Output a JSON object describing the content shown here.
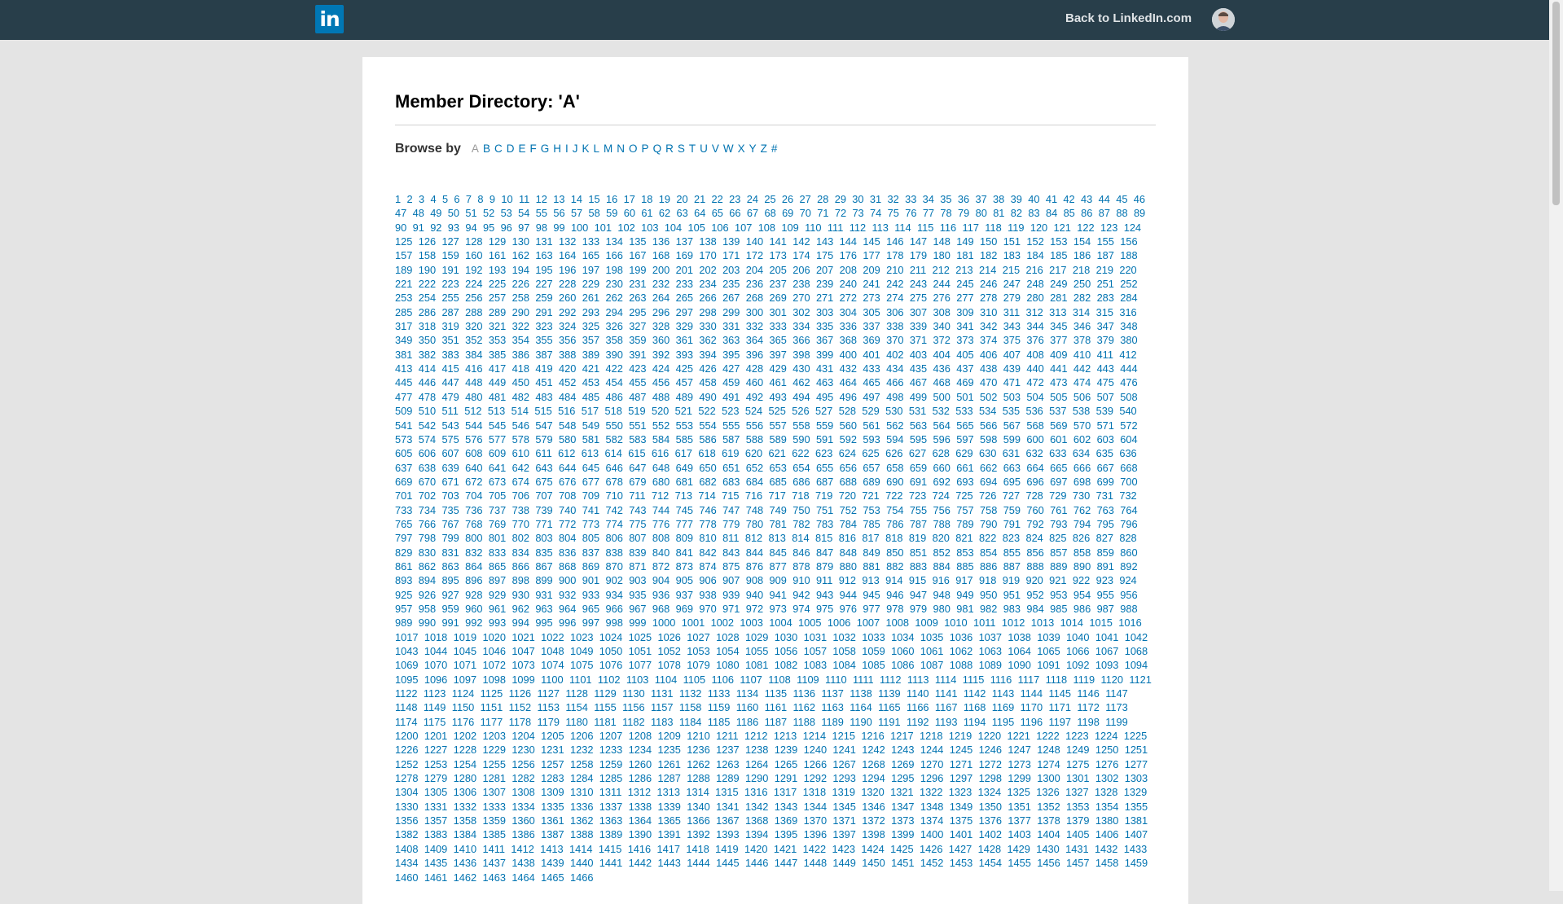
{
  "header": {
    "logo_text": "in",
    "back_link": "Back to LinkedIn.com",
    "brand_color": "#0077b5",
    "bar_color": "#283e4a"
  },
  "main": {
    "title": "Member Directory: 'A'",
    "browse_label": "Browse by",
    "active_letter": "A",
    "letters": [
      "A",
      "B",
      "C",
      "D",
      "E",
      "F",
      "G",
      "H",
      "I",
      "J",
      "K",
      "L",
      "M",
      "N",
      "O",
      "P",
      "Q",
      "R",
      "S",
      "T",
      "U",
      "V",
      "W",
      "X",
      "Y",
      "Z",
      "#"
    ],
    "page_links": {
      "first": 1,
      "last": 1466,
      "link_color": "#0073b1"
    }
  }
}
